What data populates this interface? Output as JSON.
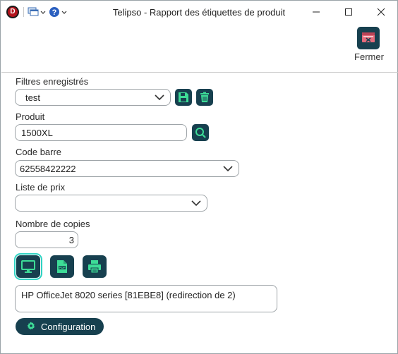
{
  "window": {
    "title": "Telipso - Rapport des étiquettes de produit",
    "app_icon_letter": "D"
  },
  "toolbar": {
    "close_label": "Fermer"
  },
  "form": {
    "saved_filters": {
      "label": "Filtres enregistrés",
      "value": "test"
    },
    "product": {
      "label": "Produit",
      "value": "1500XL"
    },
    "barcode": {
      "label": "Code barre",
      "value": "62558422222"
    },
    "price_list": {
      "label": "Liste de prix",
      "value": ""
    },
    "copies": {
      "label": "Nombre de copies",
      "value": "3"
    },
    "printer": {
      "value": "HP OfficeJet 8020 series [81EBE8] (redirection de 2)"
    },
    "configuration_label": "Configuration"
  },
  "colors": {
    "accent_dark": "#17404f",
    "accent_icon": "#3ddc97",
    "active_outline": "#2fd3c3",
    "close_icon_red": "#e56b7b"
  },
  "icons": {
    "app": "app-logo-icon",
    "save_filter": "save-icon",
    "delete_filter": "trash-icon",
    "search_product": "search-icon",
    "output_screen": "monitor-icon",
    "output_pdf": "pdf-file-icon",
    "output_printer": "printer-icon",
    "configuration": "gear-icon",
    "close": "close-window-icon"
  }
}
